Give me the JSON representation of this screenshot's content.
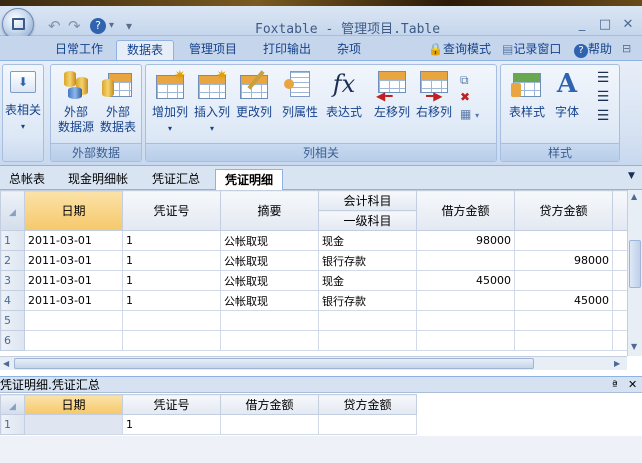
{
  "window": {
    "title": "Foxtable - 管理项目.Table",
    "controls": [
      "_",
      "□",
      "✕"
    ]
  },
  "menu_tabs": [
    {
      "label": "日常工作",
      "active": false
    },
    {
      "label": "数据表",
      "active": true
    },
    {
      "label": "管理项目",
      "active": false
    },
    {
      "label": "打印输出",
      "active": false
    },
    {
      "label": "杂项",
      "active": false
    }
  ],
  "menu_right": {
    "query_mode": "查询模式",
    "record_window": "记录窗口",
    "help": "帮助"
  },
  "ribbon": {
    "groups": [
      {
        "label": "外部数据",
        "buttons": [
          "外部数据源",
          "外部数据表"
        ]
      },
      {
        "label": "列相关",
        "buttons": [
          "增加列",
          "插入列",
          "更改列",
          "列属性",
          "表达式",
          "左移列",
          "右移列"
        ]
      },
      {
        "label": "样式",
        "buttons": [
          "表样式",
          "字体"
        ]
      }
    ],
    "left_button": "表相关",
    "ext_source_l1": "外部",
    "ext_source_l2": "数据源",
    "ext_table_l1": "外部",
    "ext_table_l2": "数据表"
  },
  "sheet_tabs": [
    {
      "label": "总帐表",
      "active": false
    },
    {
      "label": "现金明细帐",
      "active": false
    },
    {
      "label": "凭证汇总",
      "active": false
    },
    {
      "label": "凭证明细",
      "active": true
    }
  ],
  "main_table": {
    "header_top": "会计科目",
    "columns": [
      "日期",
      "凭证号",
      "摘要",
      "一级科目",
      "借方金额",
      "贷方金额"
    ],
    "rows": [
      {
        "n": "1",
        "date": "2011-03-01",
        "voucher": "1",
        "summary": "公帐取现",
        "subject": "现金",
        "debit": "98000",
        "credit": ""
      },
      {
        "n": "2",
        "date": "2011-03-01",
        "voucher": "1",
        "summary": "公帐取现",
        "subject": "银行存款",
        "debit": "",
        "credit": "98000"
      },
      {
        "n": "3",
        "date": "2011-03-01",
        "voucher": "1",
        "summary": "公帐取现",
        "subject": "现金",
        "debit": "45000",
        "credit": ""
      },
      {
        "n": "4",
        "date": "2011-03-01",
        "voucher": "1",
        "summary": "公帐取现",
        "subject": "银行存款",
        "debit": "",
        "credit": "45000"
      },
      {
        "n": "5",
        "date": "",
        "voucher": "",
        "summary": "",
        "subject": "",
        "debit": "",
        "credit": ""
      },
      {
        "n": "6",
        "date": "",
        "voucher": "",
        "summary": "",
        "subject": "",
        "debit": "",
        "credit": ""
      }
    ]
  },
  "sub_panel": {
    "title": "凭证明细.凭证汇总",
    "pin": "ª",
    "close": "✕",
    "columns": [
      "日期",
      "凭证号",
      "借方金额",
      "贷方金额"
    ],
    "rows": [
      {
        "n": "1",
        "date": "",
        "voucher": "1",
        "debit": "",
        "credit": ""
      }
    ]
  },
  "colors": {
    "accent": "#15428b",
    "ribbon_bg": "#dde8f6",
    "selected_header": "#f6c86a"
  }
}
